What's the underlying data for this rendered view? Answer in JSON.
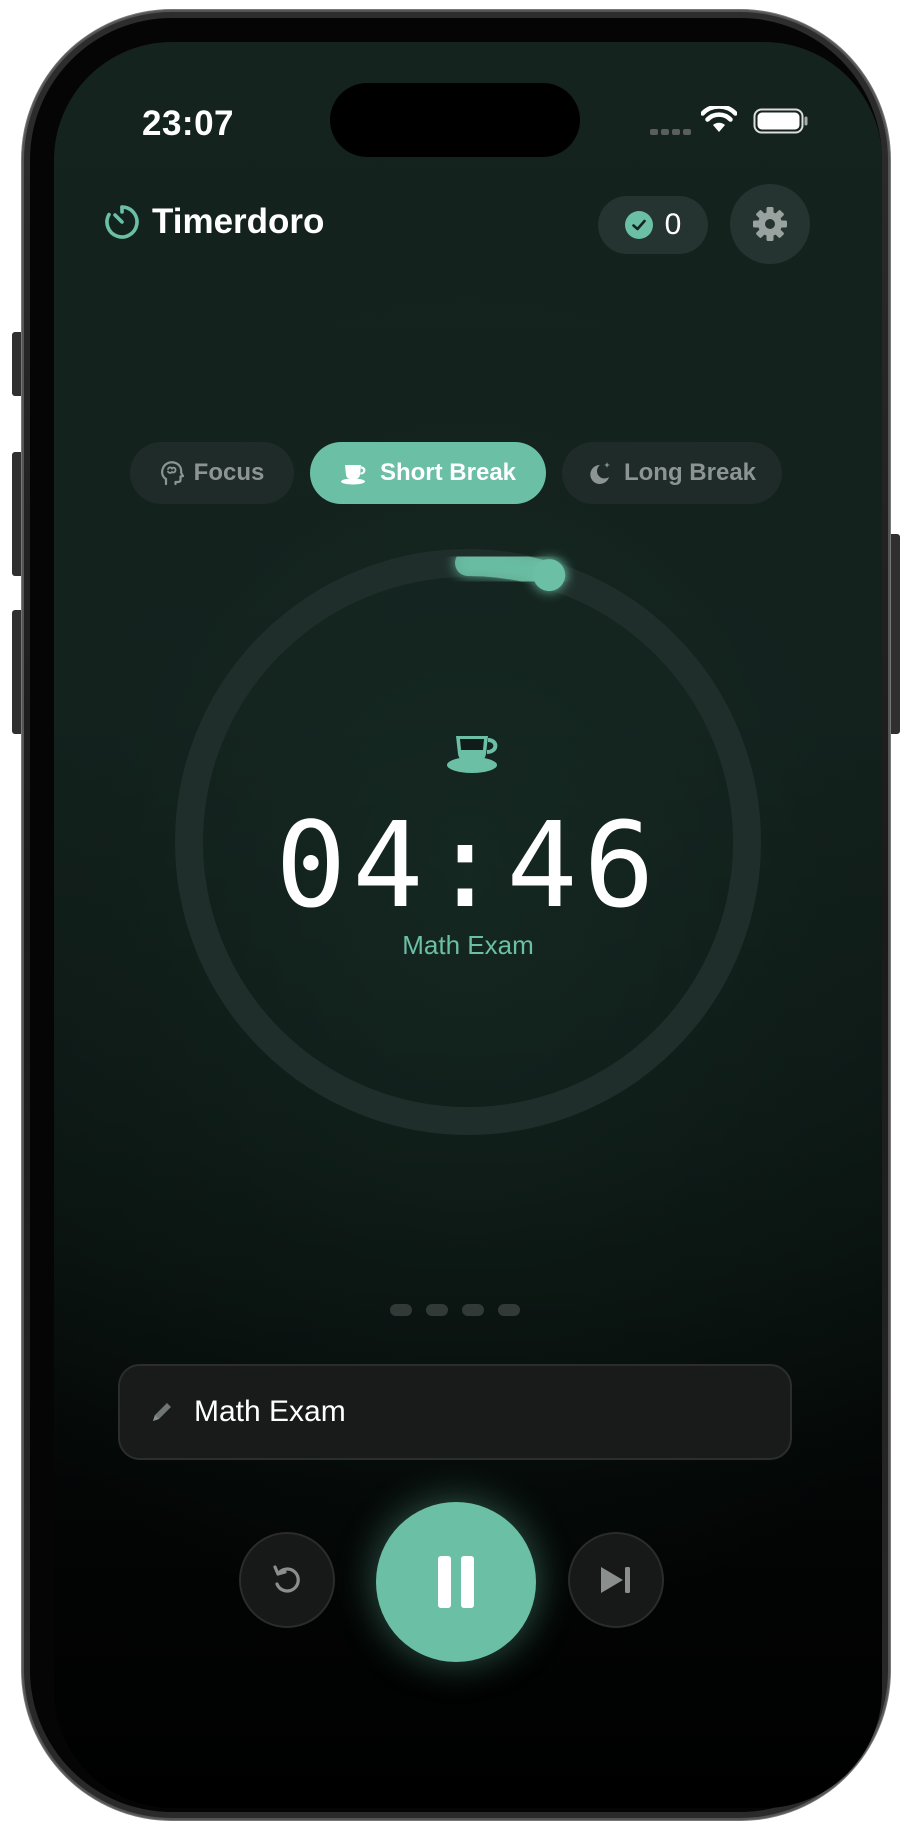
{
  "status_bar": {
    "time": "23:07"
  },
  "header": {
    "app_title": "Timerdoro",
    "completed_count": "0"
  },
  "tabs": [
    {
      "label": "Focus",
      "active": false
    },
    {
      "label": "Short Break",
      "active": true
    },
    {
      "label": "Long Break",
      "active": false
    }
  ],
  "timer": {
    "time": "04:46",
    "task_label": "Math Exam",
    "progress": 0.047
  },
  "pager": {
    "total": 4
  },
  "task_input": {
    "value": "Math Exam"
  },
  "controls": {
    "reset_icon": "reset-icon",
    "play_pause_icon": "pause-icon",
    "skip_icon": "skip-forward-icon"
  },
  "colors": {
    "accent": "#6bbfa5",
    "background": "#13211d",
    "tab_inactive_bg": "#1f2b28"
  }
}
